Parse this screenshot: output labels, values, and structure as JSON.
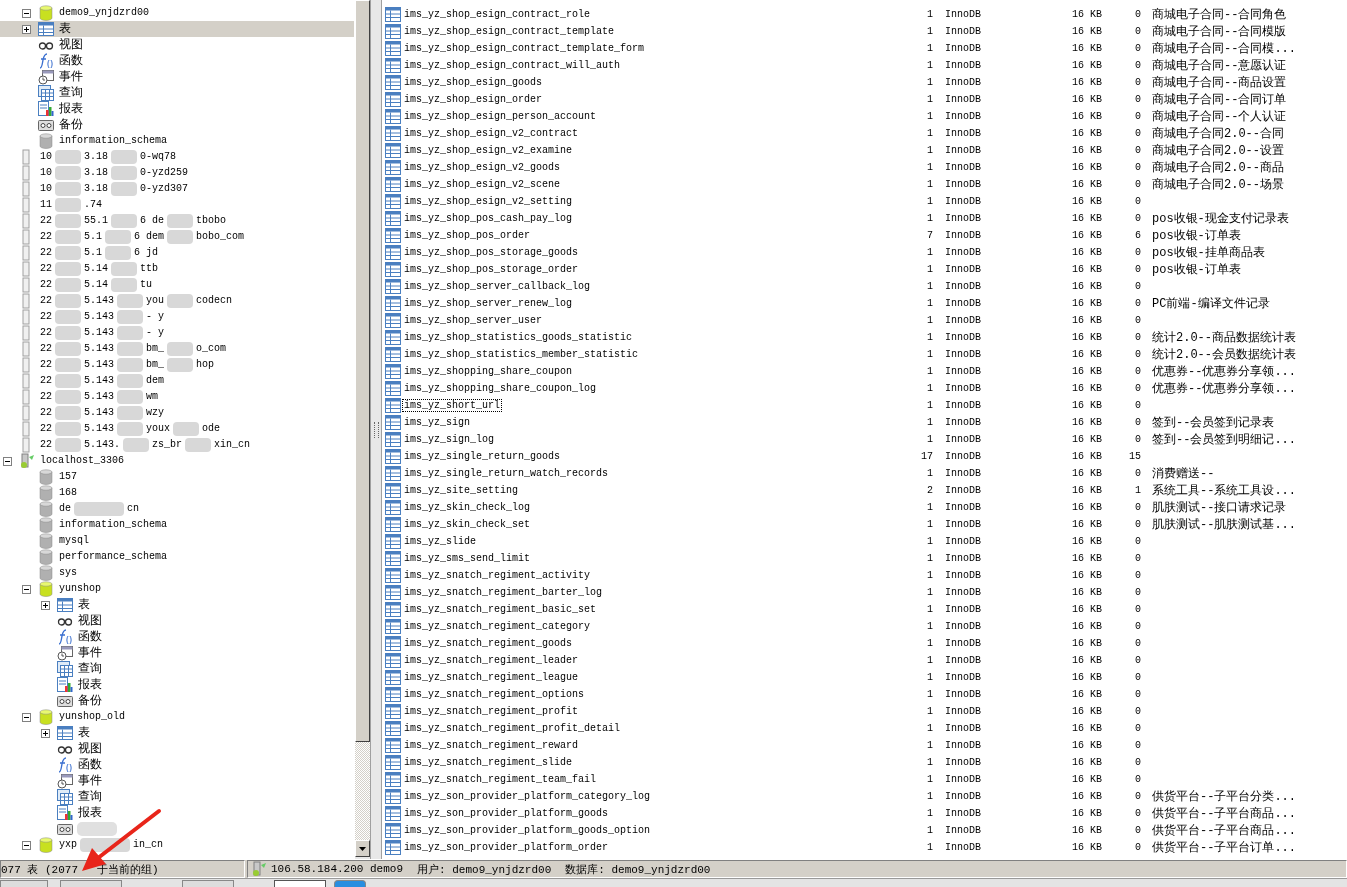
{
  "tree": [
    {
      "kind": "database",
      "open": true,
      "label": "demo9_ynjdzrd00",
      "expanded": true,
      "selected": false,
      "children": [
        {
          "kind": "tables",
          "label": "表",
          "expanded": false,
          "selected": true
        },
        {
          "kind": "views",
          "label": "视图",
          "selected": false
        },
        {
          "kind": "functions",
          "label": "函数",
          "selected": false
        },
        {
          "kind": "events",
          "label": "事件",
          "selected": false
        },
        {
          "kind": "queries",
          "label": "查询",
          "selected": false
        },
        {
          "kind": "reports",
          "label": "报表",
          "selected": false
        },
        {
          "kind": "backups",
          "label": "备份",
          "selected": false
        }
      ]
    },
    {
      "kind": "database",
      "open": false,
      "label": "information_schema",
      "selected": false
    },
    {
      "kind": "connection",
      "connected": false,
      "parts": [
        "10",
        "3.18",
        "0-wq78"
      ],
      "selected": false
    },
    {
      "kind": "connection",
      "connected": false,
      "parts": [
        "10",
        "3.18",
        "0-yzd259"
      ],
      "selected": false
    },
    {
      "kind": "connection",
      "connected": false,
      "parts": [
        "10",
        "3.18",
        "0-yzd307"
      ],
      "selected": false
    },
    {
      "kind": "connection",
      "connected": false,
      "parts": [
        "11",
        ".74"
      ],
      "selected": false
    },
    {
      "kind": "connection",
      "connected": false,
      "parts": [
        "22",
        "55.1",
        "6  de",
        "tbobo"
      ],
      "selected": false
    },
    {
      "kind": "connection",
      "connected": false,
      "parts": [
        "22",
        "5.1",
        "6 dem",
        "bobo_com"
      ],
      "selected": false
    },
    {
      "kind": "connection",
      "connected": false,
      "parts": [
        "22",
        "5.1",
        "6 jd"
      ],
      "selected": false
    },
    {
      "kind": "connection",
      "connected": false,
      "parts": [
        "22",
        "5.14",
        "ttb"
      ],
      "selected": false
    },
    {
      "kind": "connection",
      "connected": false,
      "parts": [
        "22",
        "5.14",
        "tu"
      ],
      "selected": false
    },
    {
      "kind": "connection",
      "connected": false,
      "parts": [
        "22",
        "5.143",
        "you",
        "codecn"
      ],
      "selected": false
    },
    {
      "kind": "connection",
      "connected": false,
      "parts": [
        "22",
        "5.143",
        "- y"
      ],
      "selected": false
    },
    {
      "kind": "connection",
      "connected": false,
      "parts": [
        "22",
        "5.143",
        "- y"
      ],
      "selected": false
    },
    {
      "kind": "connection",
      "connected": false,
      "parts": [
        "22",
        "5.143",
        "bm_",
        "o_com"
      ],
      "selected": false
    },
    {
      "kind": "connection",
      "connected": false,
      "parts": [
        "22",
        "5.143",
        "bm_",
        "hop"
      ],
      "selected": false
    },
    {
      "kind": "connection",
      "connected": false,
      "parts": [
        "22",
        "5.143",
        "dem"
      ],
      "selected": false
    },
    {
      "kind": "connection",
      "connected": false,
      "parts": [
        "22",
        "5.143",
        "wm"
      ],
      "selected": false
    },
    {
      "kind": "connection",
      "connected": false,
      "parts": [
        "22",
        "5.143",
        "wzy"
      ],
      "selected": false
    },
    {
      "kind": "connection",
      "connected": false,
      "parts": [
        "22",
        "5.143",
        "youx",
        "ode"
      ],
      "selected": false
    },
    {
      "kind": "connection",
      "connected": false,
      "parts": [
        "22",
        "5.143.",
        "zs_br",
        "xin_cn"
      ],
      "selected": false
    },
    {
      "kind": "connection",
      "connected": true,
      "label": "localhost_3306",
      "expanded": true,
      "selected": false,
      "children": [
        {
          "kind": "database",
          "open": false,
          "label": "157",
          "selected": false
        },
        {
          "kind": "database",
          "open": false,
          "label": "168",
          "selected": false
        },
        {
          "kind": "database",
          "open": false,
          "parts": [
            "de",
            "cn"
          ],
          "selected": false
        },
        {
          "kind": "database",
          "open": false,
          "label": "information_schema",
          "selected": false
        },
        {
          "kind": "database",
          "open": false,
          "label": "mysql",
          "selected": false
        },
        {
          "kind": "database",
          "open": false,
          "label": "performance_schema",
          "selected": false
        },
        {
          "kind": "database",
          "open": false,
          "label": "sys",
          "selected": false
        },
        {
          "kind": "database",
          "open": true,
          "label": "yunshop",
          "expanded": true,
          "selected": false,
          "children": [
            {
              "kind": "tables",
              "label": "表",
              "expanded": false,
              "selected": false
            },
            {
              "kind": "views",
              "label": "视图",
              "selected": false
            },
            {
              "kind": "functions",
              "label": "函数",
              "selected": false
            },
            {
              "kind": "events",
              "label": "事件",
              "selected": false
            },
            {
              "kind": "queries",
              "label": "查询",
              "selected": false
            },
            {
              "kind": "reports",
              "label": "报表",
              "selected": false
            },
            {
              "kind": "backups",
              "label": "备份",
              "selected": false
            }
          ]
        },
        {
          "kind": "database",
          "open": true,
          "label": "yunshop_old",
          "expanded": true,
          "selected": false,
          "children": [
            {
              "kind": "tables",
              "label": "表",
              "expanded": false,
              "selected": false
            },
            {
              "kind": "views",
              "label": "视图",
              "selected": false
            },
            {
              "kind": "functions",
              "label": "函数",
              "selected": false
            },
            {
              "kind": "events",
              "label": "事件",
              "selected": false
            },
            {
              "kind": "queries",
              "label": "查询",
              "selected": false
            },
            {
              "kind": "reports",
              "label": "报表",
              "selected": false
            },
            {
              "kind": "backups",
              "redacted": true,
              "selected": false
            }
          ]
        },
        {
          "kind": "database",
          "open": true,
          "parts": [
            "yxp",
            "in_cn"
          ],
          "expanded": true,
          "selected": false
        }
      ]
    }
  ],
  "tables": [
    {
      "name": "ims_yz_shop_esign_contract_role",
      "column_2": "1",
      "engine": "InnoDB",
      "size": "16 KB",
      "column_5": "0",
      "comment": "商城电子合同--合同角色",
      "selected": false
    },
    {
      "name": "ims_yz_shop_esign_contract_template",
      "column_2": "1",
      "engine": "InnoDB",
      "size": "16 KB",
      "column_5": "0",
      "comment": "商城电子合同--合同模版",
      "selected": false
    },
    {
      "name": "ims_yz_shop_esign_contract_template_form",
      "column_2": "1",
      "engine": "InnoDB",
      "size": "16 KB",
      "column_5": "0",
      "comment": "商城电子合同--合同模...",
      "selected": false
    },
    {
      "name": "ims_yz_shop_esign_contract_will_auth",
      "column_2": "1",
      "engine": "InnoDB",
      "size": "16 KB",
      "column_5": "0",
      "comment": "商城电子合同--意愿认证",
      "selected": false
    },
    {
      "name": "ims_yz_shop_esign_goods",
      "column_2": "1",
      "engine": "InnoDB",
      "size": "16 KB",
      "column_5": "0",
      "comment": "商城电子合同--商品设置",
      "selected": false
    },
    {
      "name": "ims_yz_shop_esign_order",
      "column_2": "1",
      "engine": "InnoDB",
      "size": "16 KB",
      "column_5": "0",
      "comment": "商城电子合同--合同订单",
      "selected": false
    },
    {
      "name": "ims_yz_shop_esign_person_account",
      "column_2": "1",
      "engine": "InnoDB",
      "size": "16 KB",
      "column_5": "0",
      "comment": "商城电子合同--个人认证",
      "selected": false
    },
    {
      "name": "ims_yz_shop_esign_v2_contract",
      "column_2": "1",
      "engine": "InnoDB",
      "size": "16 KB",
      "column_5": "0",
      "comment": "商城电子合同2.0--合同",
      "selected": false
    },
    {
      "name": "ims_yz_shop_esign_v2_examine",
      "column_2": "1",
      "engine": "InnoDB",
      "size": "16 KB",
      "column_5": "0",
      "comment": "商城电子合同2.0--设置",
      "selected": false
    },
    {
      "name": "ims_yz_shop_esign_v2_goods",
      "column_2": "1",
      "engine": "InnoDB",
      "size": "16 KB",
      "column_5": "0",
      "comment": "商城电子合同2.0--商品",
      "selected": false
    },
    {
      "name": "ims_yz_shop_esign_v2_scene",
      "column_2": "1",
      "engine": "InnoDB",
      "size": "16 KB",
      "column_5": "0",
      "comment": "商城电子合同2.0--场景",
      "selected": false
    },
    {
      "name": "ims_yz_shop_esign_v2_setting",
      "column_2": "1",
      "engine": "InnoDB",
      "size": "16 KB",
      "column_5": "0",
      "selected": false
    },
    {
      "name": "ims_yz_shop_pos_cash_pay_log",
      "column_2": "1",
      "engine": "InnoDB",
      "size": "16 KB",
      "column_5": "0",
      "comment": "pos收银-现金支付记录表",
      "selected": false
    },
    {
      "name": "ims_yz_shop_pos_order",
      "column_2": "7",
      "engine": "InnoDB",
      "size": "16 KB",
      "column_5": "6",
      "comment": "pos收银-订单表",
      "selected": false
    },
    {
      "name": "ims_yz_shop_pos_storage_goods",
      "column_2": "1",
      "engine": "InnoDB",
      "size": "16 KB",
      "column_5": "0",
      "comment": "pos收银-挂单商品表",
      "selected": false
    },
    {
      "name": "ims_yz_shop_pos_storage_order",
      "column_2": "1",
      "engine": "InnoDB",
      "size": "16 KB",
      "column_5": "0",
      "comment": "pos收银-订单表",
      "selected": false
    },
    {
      "name": "ims_yz_shop_server_callback_log",
      "column_2": "1",
      "engine": "InnoDB",
      "size": "16 KB",
      "column_5": "0",
      "selected": false
    },
    {
      "name": "ims_yz_shop_server_renew_log",
      "column_2": "1",
      "engine": "InnoDB",
      "size": "16 KB",
      "column_5": "0",
      "comment": "PC前端-编译文件记录",
      "selected": false
    },
    {
      "name": "ims_yz_shop_server_user",
      "column_2": "1",
      "engine": "InnoDB",
      "size": "16 KB",
      "column_5": "0",
      "selected": false
    },
    {
      "name": "ims_yz_shop_statistics_goods_statistic",
      "column_2": "1",
      "engine": "InnoDB",
      "size": "16 KB",
      "column_5": "0",
      "comment": "统计2.0--商品数据统计表",
      "selected": false
    },
    {
      "name": "ims_yz_shop_statistics_member_statistic",
      "column_2": "1",
      "engine": "InnoDB",
      "size": "16 KB",
      "column_5": "0",
      "comment": "统计2.0--会员数据统计表",
      "selected": false
    },
    {
      "name": "ims_yz_shopping_share_coupon",
      "column_2": "1",
      "engine": "InnoDB",
      "size": "16 KB",
      "column_5": "0",
      "comment": "优惠券--优惠券分享领...",
      "selected": false
    },
    {
      "name": "ims_yz_shopping_share_coupon_log",
      "column_2": "1",
      "engine": "InnoDB",
      "size": "16 KB",
      "column_5": "0",
      "comment": "优惠券--优惠券分享领...",
      "selected": false
    },
    {
      "name": "ims_yz_short_url",
      "column_2": "1",
      "engine": "InnoDB",
      "size": "16 KB",
      "column_5": "0",
      "selected": true
    },
    {
      "name": "ims_yz_sign",
      "column_2": "1",
      "engine": "InnoDB",
      "size": "16 KB",
      "column_5": "0",
      "comment": "签到--会员签到记录表",
      "selected": false
    },
    {
      "name": "ims_yz_sign_log",
      "column_2": "1",
      "engine": "InnoDB",
      "size": "16 KB",
      "column_5": "0",
      "comment": "签到--会员签到明细记...",
      "selected": false
    },
    {
      "name": "ims_yz_single_return_goods",
      "column_2": "17",
      "engine": "InnoDB",
      "size": "16 KB",
      "column_5": "15",
      "selected": false
    },
    {
      "name": "ims_yz_single_return_watch_records",
      "column_2": "1",
      "engine": "InnoDB",
      "size": "16 KB",
      "column_5": "0",
      "comment": "消费赠送--",
      "selected": false
    },
    {
      "name": "ims_yz_site_setting",
      "column_2": "2",
      "engine": "InnoDB",
      "size": "16 KB",
      "column_5": "1",
      "comment": "系统工具--系统工具设...",
      "selected": false
    },
    {
      "name": "ims_yz_skin_check_log",
      "column_2": "1",
      "engine": "InnoDB",
      "size": "16 KB",
      "column_5": "0",
      "comment": "肌肤测试--接口请求记录",
      "selected": false
    },
    {
      "name": "ims_yz_skin_check_set",
      "column_2": "1",
      "engine": "InnoDB",
      "size": "16 KB",
      "column_5": "0",
      "comment": "肌肤测试--肌肤测试基...",
      "selected": false
    },
    {
      "name": "ims_yz_slide",
      "column_2": "1",
      "engine": "InnoDB",
      "size": "16 KB",
      "column_5": "0",
      "selected": false
    },
    {
      "name": "ims_yz_sms_send_limit",
      "column_2": "1",
      "engine": "InnoDB",
      "size": "16 KB",
      "column_5": "0",
      "selected": false
    },
    {
      "name": "ims_yz_snatch_regiment_activity",
      "column_2": "1",
      "engine": "InnoDB",
      "size": "16 KB",
      "column_5": "0",
      "selected": false
    },
    {
      "name": "ims_yz_snatch_regiment_barter_log",
      "column_2": "1",
      "engine": "InnoDB",
      "size": "16 KB",
      "column_5": "0",
      "selected": false
    },
    {
      "name": "ims_yz_snatch_regiment_basic_set",
      "column_2": "1",
      "engine": "InnoDB",
      "size": "16 KB",
      "column_5": "0",
      "selected": false
    },
    {
      "name": "ims_yz_snatch_regiment_category",
      "column_2": "1",
      "engine": "InnoDB",
      "size": "16 KB",
      "column_5": "0",
      "selected": false
    },
    {
      "name": "ims_yz_snatch_regiment_goods",
      "column_2": "1",
      "engine": "InnoDB",
      "size": "16 KB",
      "column_5": "0",
      "selected": false
    },
    {
      "name": "ims_yz_snatch_regiment_leader",
      "column_2": "1",
      "engine": "InnoDB",
      "size": "16 KB",
      "column_5": "0",
      "selected": false
    },
    {
      "name": "ims_yz_snatch_regiment_league",
      "column_2": "1",
      "engine": "InnoDB",
      "size": "16 KB",
      "column_5": "0",
      "selected": false
    },
    {
      "name": "ims_yz_snatch_regiment_options",
      "column_2": "1",
      "engine": "InnoDB",
      "size": "16 KB",
      "column_5": "0",
      "selected": false
    },
    {
      "name": "ims_yz_snatch_regiment_profit",
      "column_2": "1",
      "engine": "InnoDB",
      "size": "16 KB",
      "column_5": "0",
      "selected": false
    },
    {
      "name": "ims_yz_snatch_regiment_profit_detail",
      "column_2": "1",
      "engine": "InnoDB",
      "size": "16 KB",
      "column_5": "0",
      "selected": false
    },
    {
      "name": "ims_yz_snatch_regiment_reward",
      "column_2": "1",
      "engine": "InnoDB",
      "size": "16 KB",
      "column_5": "0",
      "selected": false
    },
    {
      "name": "ims_yz_snatch_regiment_slide",
      "column_2": "1",
      "engine": "InnoDB",
      "size": "16 KB",
      "column_5": "0",
      "selected": false
    },
    {
      "name": "ims_yz_snatch_regiment_team_fail",
      "column_2": "1",
      "engine": "InnoDB",
      "size": "16 KB",
      "column_5": "0",
      "selected": false
    },
    {
      "name": "ims_yz_son_provider_platform_category_log",
      "column_2": "1",
      "engine": "InnoDB",
      "size": "16 KB",
      "column_5": "0",
      "comment": "供货平台--子平台分类...",
      "selected": false
    },
    {
      "name": "ims_yz_son_provider_platform_goods",
      "column_2": "1",
      "engine": "InnoDB",
      "size": "16 KB",
      "column_5": "0",
      "comment": "供货平台--子平台商品...",
      "selected": false
    },
    {
      "name": "ims_yz_son_provider_platform_goods_option",
      "column_2": "1",
      "engine": "InnoDB",
      "size": "16 KB",
      "column_5": "0",
      "comment": "供货平台--子平台商品...",
      "selected": false
    },
    {
      "name": "ims_yz_son_provider_platform_order",
      "column_2": "1",
      "engine": "InnoDB",
      "size": "16 KB",
      "column_5": "0",
      "comment": "供货平台--子平台订单...",
      "selected": false
    }
  ],
  "status_bar": {
    "count": "077 表 (2077",
    "count_rest": "于当前的组)",
    "server": "106.58.184.200 demo9",
    "user": "用户: demo9_ynjdzrd00",
    "database": "数据库: demo9_ynjdzrd00"
  }
}
